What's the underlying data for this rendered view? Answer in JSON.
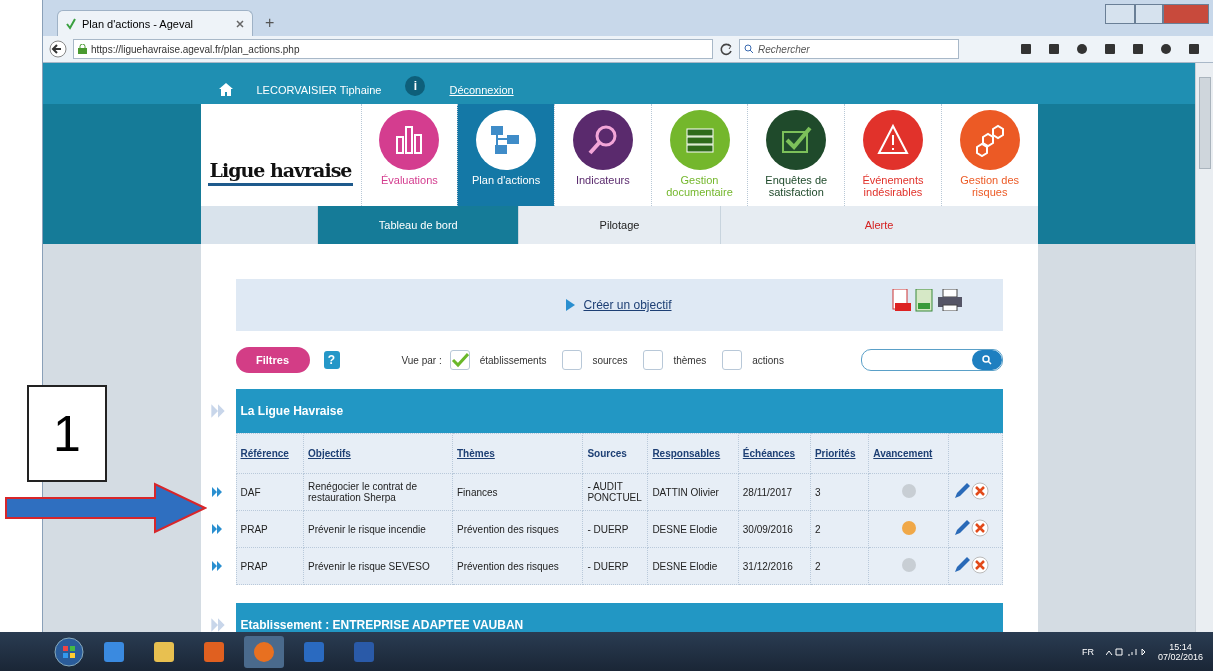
{
  "browser": {
    "tab_title": "Plan d'actions - Ageval",
    "new_tab": "+",
    "url": "https://liguehavraise.ageval.fr/plan_actions.php",
    "search_placeholder": "Rechercher"
  },
  "header": {
    "user": "LECORVAISIER Tiphaine",
    "info": "i",
    "logout": "Déconnexion"
  },
  "logo": {
    "name": "Ligue havraise"
  },
  "modules": [
    {
      "label": "Évaluations",
      "kind": "bars",
      "color": "#d43d8f",
      "selected": false
    },
    {
      "label": "Plan d'actions",
      "kind": "folders",
      "color": "#1478a6",
      "selected": true
    },
    {
      "label": "Indicateurs",
      "kind": "magnifier",
      "color": "#5a2a6d",
      "selected": false
    },
    {
      "label": "Gestion documentaire",
      "kind": "books",
      "color": "#74b72c",
      "selected": false
    },
    {
      "label": "Enquêtes de satisfaction",
      "kind": "check",
      "color": "#1f4a2b",
      "selected": false
    },
    {
      "label": "Événements indésirables",
      "kind": "warning",
      "color": "#e1322b",
      "selected": false
    },
    {
      "label": "Gestion des risques",
      "kind": "hexagons",
      "color": "#ec5a25",
      "selected": false
    }
  ],
  "subtabs": [
    {
      "label": "Tableau de bord",
      "kind": "normal",
      "selected": true
    },
    {
      "label": "Pilotage",
      "kind": "normal",
      "selected": false
    },
    {
      "label": "Alerte",
      "kind": "alert",
      "selected": false
    }
  ],
  "create_link": "Créer un objectif",
  "filters": {
    "button": "Filtres",
    "help": "?",
    "view_label": "Vue par :",
    "options": [
      {
        "label": "établissements",
        "checked": true
      },
      {
        "label": "sources",
        "checked": false
      },
      {
        "label": "thèmes",
        "checked": false
      },
      {
        "label": "actions",
        "checked": false
      }
    ]
  },
  "groups": [
    {
      "title": "La Ligue Havraise",
      "columns": [
        "Référence",
        "Objectifs",
        "Thèmes",
        "Sources",
        "Responsables",
        "Échéances",
        "Priorités",
        "Avancement"
      ],
      "rows": [
        {
          "reference": "DAF",
          "objective": "Renégocier le contrat de restauration Sherpa",
          "theme": "Finances",
          "source": "- AUDIT PONCTUEL",
          "owner": "DATTIN Olivier",
          "due": "28/11/2017",
          "priority": "3",
          "color": "#c8ced4"
        },
        {
          "reference": "PRAP",
          "objective": "Prévenir le risque incendie",
          "theme": "Prévention des risques",
          "source": "- DUERP",
          "owner": "DESNE Elodie",
          "due": "30/09/2016",
          "priority": "2",
          "color": "#f0a848"
        },
        {
          "reference": "PRAP",
          "objective": "Prévenir le risque SEVESO",
          "theme": "Prévention des risques",
          "source": "- DUERP",
          "owner": "DESNE Elodie",
          "due": "31/12/2016",
          "priority": "2",
          "color": "#c8ced4"
        }
      ]
    },
    {
      "title": "Etablissement : ENTREPRISE ADAPTEE VAUBAN"
    }
  ],
  "taskbar": {
    "language": "FR",
    "time": "15:14",
    "date": "07/02/2016"
  },
  "annotation": {
    "label": "1"
  }
}
